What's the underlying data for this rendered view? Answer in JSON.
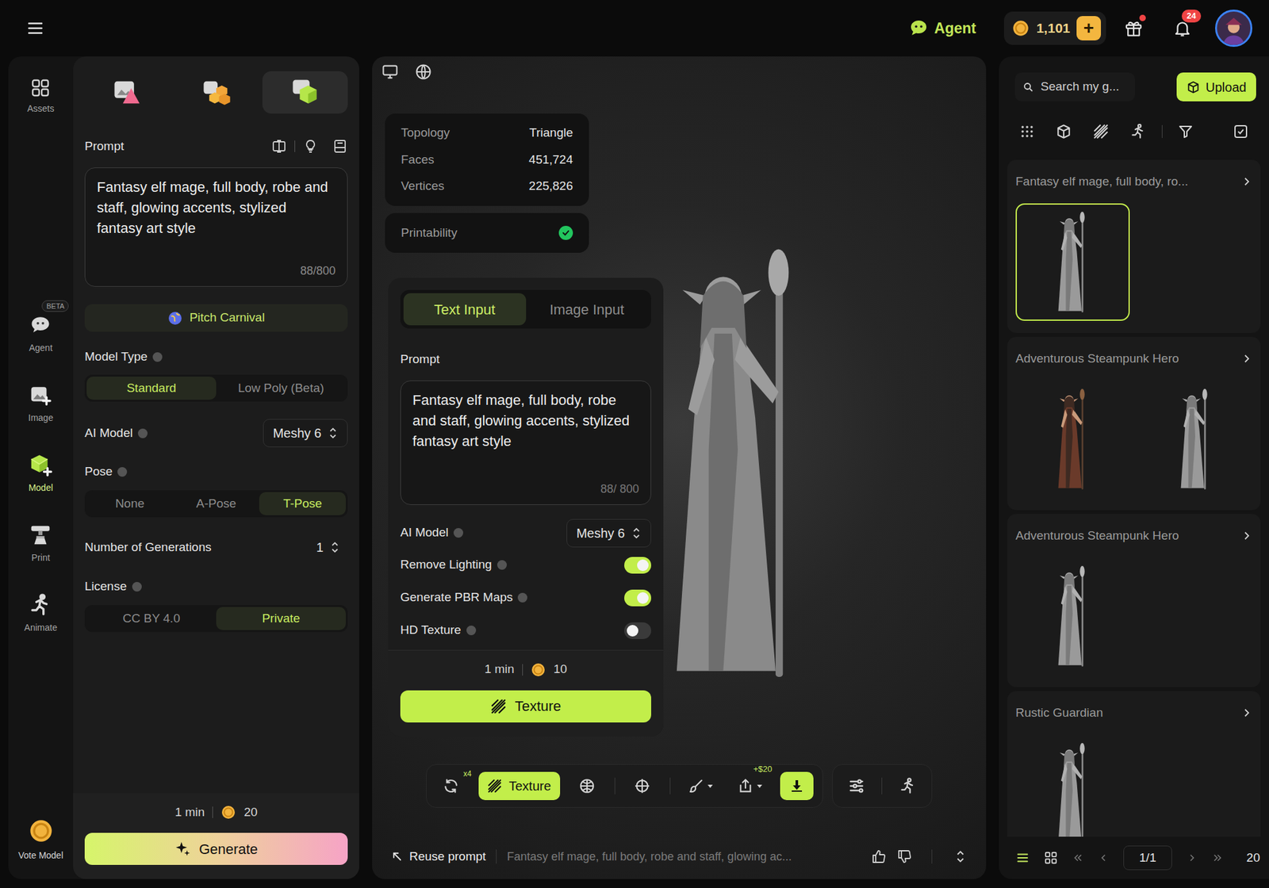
{
  "topbar": {
    "agent": "Agent",
    "credits": "1,101",
    "credits_add": "+",
    "gift": {
      "unread": true
    },
    "notifications": {
      "count": "24"
    }
  },
  "rail": {
    "items": [
      {
        "label": "Assets",
        "selected": false
      },
      {
        "label": "Agent",
        "badge": "BETA",
        "selected": false
      },
      {
        "label": "Image",
        "selected": false
      },
      {
        "label": "Model",
        "selected": true
      },
      {
        "label": "Print",
        "selected": false
      },
      {
        "label": "Animate",
        "selected": false
      }
    ],
    "vote": "Vote Model"
  },
  "generator": {
    "tabs": [
      {
        "selected": false
      },
      {
        "selected": false
      },
      {
        "selected": true
      }
    ],
    "prompt": {
      "label": "Prompt",
      "text": "Fantasy elf mage, full body, robe and staff, glowing accents, stylized fantasy art style",
      "counter": "88/800"
    },
    "pitch": "Pitch Carnival",
    "model_type": {
      "label": "Model Type",
      "options": [
        {
          "label": "Standard",
          "selected": true
        },
        {
          "label": "Low Poly (Beta)",
          "selected": false
        }
      ]
    },
    "ai_model": {
      "label": "AI Model",
      "value": "Meshy 6"
    },
    "pose": {
      "label": "Pose",
      "options": [
        {
          "label": "None",
          "selected": false
        },
        {
          "label": "A-Pose",
          "selected": false
        },
        {
          "label": "T-Pose",
          "selected": true
        }
      ]
    },
    "generations": {
      "label": "Number of Generations",
      "value": "1"
    },
    "license": {
      "label": "License",
      "options": [
        {
          "label": "CC BY 4.0",
          "selected": false
        },
        {
          "label": "Private",
          "selected": true
        }
      ]
    },
    "footer": {
      "time": "1 min",
      "cost": "20",
      "button": "Generate"
    }
  },
  "viewer": {
    "stats": [
      {
        "label": "Topology",
        "value": "Triangle"
      },
      {
        "label": "Faces",
        "value": "451,724"
      },
      {
        "label": "Vertices",
        "value": "225,826"
      }
    ],
    "printability": {
      "label": "Printability",
      "ok": true
    },
    "texture_panel": {
      "tabs": [
        {
          "label": "Text Input",
          "selected": true
        },
        {
          "label": "Image Input",
          "selected": false
        }
      ],
      "prompt_label": "Prompt",
      "prompt": "Fantasy elf mage, full body, robe and staff, glowing accents, stylized fantasy art style",
      "counter": "88/ 800",
      "ai_model": {
        "label": "AI Model",
        "value": "Meshy 6"
      },
      "toggles": [
        {
          "label": "Remove Lighting",
          "on": true
        },
        {
          "label": "Generate PBR Maps",
          "on": true
        },
        {
          "label": "HD Texture",
          "on": false
        }
      ],
      "time": "1 min",
      "cost": "10",
      "button": "Texture"
    },
    "toolbar": [
      {
        "badge": "x4",
        "highlighted": false
      },
      {
        "label": "Texture",
        "highlighted": true
      },
      {
        "highlighted": false
      },
      {
        "highlighted": false
      },
      {
        "highlighted": false
      },
      {
        "badge": "+$20",
        "highlighted": false
      },
      {
        "highlighted": true
      }
    ],
    "bottom": {
      "reuse": "Reuse prompt",
      "prompt": "Fantasy elf mage, full body, robe and staff, glowing ac..."
    }
  },
  "library": {
    "search": {
      "placeholder": "Search my g..."
    },
    "upload": "Upload",
    "groups": [
      {
        "title": "Fantasy elf mage, full body, ro...",
        "thumbs": [
          {
            "selected": true
          }
        ]
      },
      {
        "title": "Adventurous Steampunk Hero",
        "thumbs": [
          {
            "selected": false
          },
          {
            "selected": false
          }
        ]
      },
      {
        "title": "Adventurous Steampunk Hero",
        "thumbs": [
          {
            "selected": false
          }
        ]
      },
      {
        "title": "Rustic Guardian",
        "thumbs": [
          {
            "selected": false
          }
        ]
      }
    ],
    "pagination": {
      "page": "1/1",
      "per_page": "20"
    }
  }
}
